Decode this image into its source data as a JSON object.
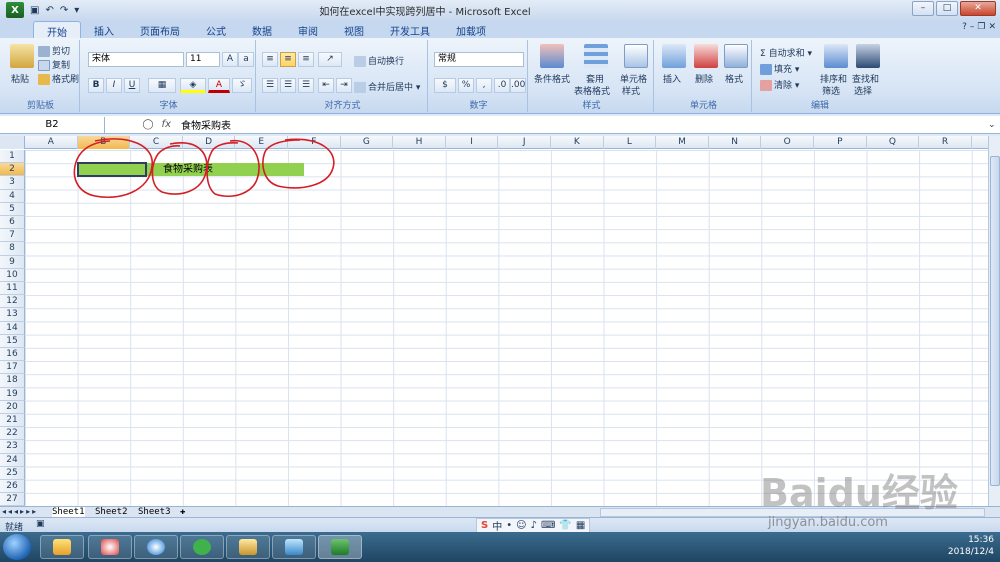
{
  "window": {
    "title": "如何在excel中实现跨列居中 - Microsoft Excel"
  },
  "tabs": [
    "开始",
    "插入",
    "页面布局",
    "公式",
    "数据",
    "审阅",
    "视图",
    "开发工具",
    "加载项"
  ],
  "ribbon": {
    "clipboard": {
      "paste": "粘贴",
      "cut": "剪切",
      "copy": "复制",
      "format_painter": "格式刷",
      "label": "剪贴板"
    },
    "font": {
      "name": "宋体",
      "size": "11",
      "bold": "B",
      "italic": "I",
      "underline": "U",
      "label": "字体"
    },
    "alignment": {
      "wrap": "自动换行",
      "merge": "合并后居中",
      "label": "对齐方式"
    },
    "number": {
      "format": "常规",
      "percent": "%",
      "label": "数字"
    },
    "styles": {
      "conditional": "条件格式",
      "table_format_1": "套用",
      "table_format_2": "表格格式",
      "cell_style_1": "单元格",
      "cell_style_2": "样式",
      "label": "样式"
    },
    "cells": {
      "insert": "插入",
      "delete": "删除",
      "format": "格式",
      "label": "单元格"
    },
    "editing": {
      "autosum": "自动求和",
      "fill": "填充",
      "clear": "清除",
      "sort_1": "排序和",
      "sort_2": "筛选",
      "find_1": "查找和",
      "find_2": "选择",
      "label": "编辑"
    }
  },
  "formula_bar": {
    "name_box": "B2",
    "fx": "fx",
    "content": "食物采购表"
  },
  "columns": [
    "A",
    "B",
    "C",
    "D",
    "E",
    "F",
    "G",
    "H",
    "I",
    "J",
    "K",
    "L",
    "M",
    "N",
    "O",
    "P",
    "Q",
    "R"
  ],
  "rows": [
    "1",
    "2",
    "3",
    "4",
    "5",
    "6",
    "7",
    "8",
    "9",
    "10",
    "11",
    "12",
    "13",
    "14",
    "15",
    "16",
    "17",
    "18",
    "19",
    "20",
    "21",
    "22",
    "23",
    "24",
    "25",
    "26",
    "27"
  ],
  "cell_text": "食物采购表",
  "colors": {
    "fill": "#92d050",
    "annotation": "#d41e26"
  },
  "sheets": [
    "Sheet1",
    "Sheet2",
    "Sheet3"
  ],
  "status": {
    "ready": "就绪"
  },
  "ime": {
    "label": "中"
  },
  "tray": {
    "time": "15:36",
    "date": "2018/12/4"
  },
  "watermark": {
    "logo": "Baidu经验",
    "url": "jingyan.baidu.com"
  }
}
